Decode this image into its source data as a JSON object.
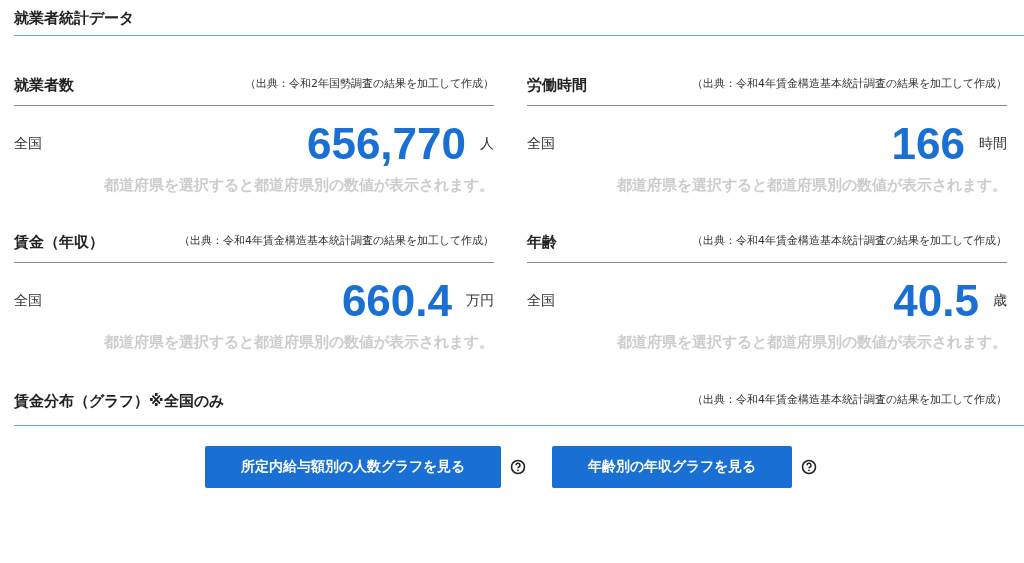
{
  "title": "就業者統計データ",
  "stats": [
    {
      "label": "就業者数",
      "source": "（出典：令和2年国勢調査の結果を加工して作成）",
      "area": "全国",
      "value": "656,770",
      "unit": "人",
      "note": "都道府県を選択すると都道府県別の数値が表示されます。"
    },
    {
      "label": "労働時間",
      "source": "（出典：令和4年賃金構造基本統計調査の結果を加工して作成）",
      "area": "全国",
      "value": "166",
      "unit": "時間",
      "note": "都道府県を選択すると都道府県別の数値が表示されます。"
    },
    {
      "label": "賃金（年収）",
      "source": "（出典：令和4年賃金構造基本統計調査の結果を加工して作成）",
      "area": "全国",
      "value": "660.4",
      "unit": "万円",
      "note": "都道府県を選択すると都道府県別の数値が表示されます。"
    },
    {
      "label": "年齢",
      "source": "（出典：令和4年賃金構造基本統計調査の結果を加工して作成）",
      "area": "全国",
      "value": "40.5",
      "unit": "歳",
      "note": "都道府県を選択すると都道府県別の数値が表示されます。"
    }
  ],
  "distribution": {
    "label": "賃金分布（グラフ）※全国のみ",
    "source": "（出典：令和4年賃金構造基本統計調査の結果を加工して作成）",
    "buttons": [
      {
        "label": "所定内給与額別の人数グラフを見る"
      },
      {
        "label": "年齢別の年収グラフを見る"
      }
    ]
  }
}
